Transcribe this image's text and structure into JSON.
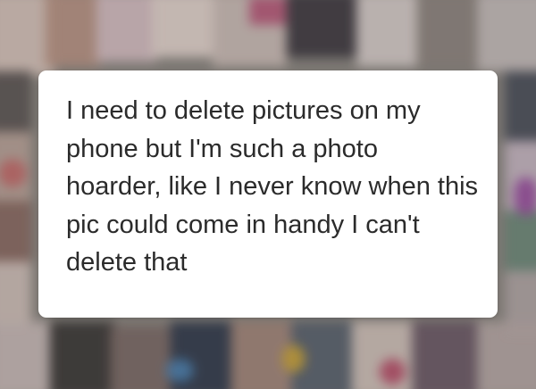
{
  "card": {
    "text": "I need to delete pictures on my phone but I'm such a photo hoarder, like I never know when this pic could come in handy I can't delete that"
  },
  "background": {
    "description_colors": [
      "#c9b8b0",
      "#7a6e68",
      "#d8c7c2",
      "#5a5250",
      "#b89a8e",
      "#3d3a40",
      "#e2d6d3",
      "#6f7a86",
      "#a58e7c",
      "#2e3a4a"
    ]
  }
}
